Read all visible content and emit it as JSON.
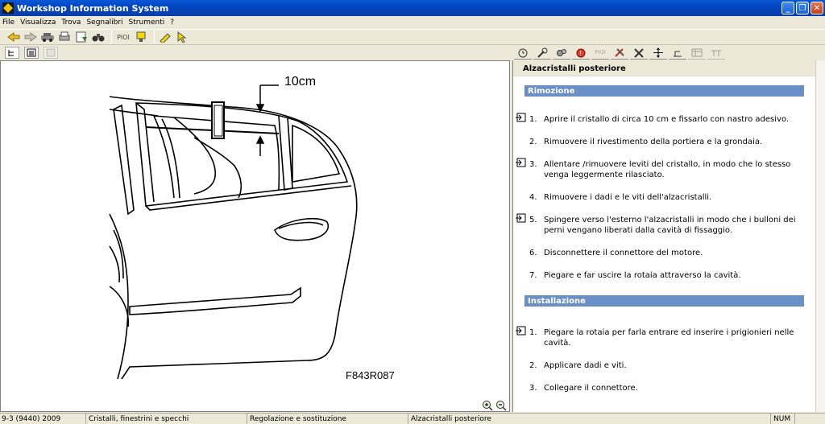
{
  "window": {
    "title": "Workshop Information System"
  },
  "menu": [
    "File",
    "Visualizza",
    "Trova",
    "Segnalibri",
    "Strumenti",
    "?"
  ],
  "toolbar": {
    "pioi_label": "PIOI"
  },
  "toolbar_right": {
    "pioi_label": "PIOI"
  },
  "figure": {
    "measure_label": "10cm",
    "code": "F843R087"
  },
  "doc": {
    "title": "Alzacristalli posteriore",
    "removal_heading": "Rimozione",
    "removal_steps": [
      {
        "n": "1.",
        "text": "Aprire il cristallo di circa 10 cm e fissarlo con nastro adesivo.",
        "link": true
      },
      {
        "n": "2.",
        "text": "Rimuovere il rivestimento della portiera e la grondaia.",
        "link": false
      },
      {
        "n": "3.",
        "text": "Allentare /rimuovere leviti del cristallo, in modo che lo stesso venga leggermente rilasciato.",
        "link": true
      },
      {
        "n": "4.",
        "text": "Rimuovere i dadi e le viti dell'alzacristalli.",
        "link": false
      },
      {
        "n": "5.",
        "text": "Spingere verso l'esterno l'alzacristalli in modo che i bulloni dei perni vengano liberati dalla cavità di fissaggio.",
        "link": true
      },
      {
        "n": "6.",
        "text": "Disconnettere il connettore del motore.",
        "link": false
      },
      {
        "n": "7.",
        "text": "Piegare e far uscire la rotaia attraverso la cavità.",
        "link": false
      }
    ],
    "install_heading": "Installazione",
    "install_steps": [
      {
        "n": "1.",
        "text": "Piegare la rotaia per farla entrare ed inserire i prigionieri nelle cavità.",
        "link": true
      },
      {
        "n": "2.",
        "text": "Applicare dadi e viti.",
        "link": false
      },
      {
        "n": "3.",
        "text": "Collegare il connettore.",
        "link": false
      }
    ]
  },
  "status": {
    "model": "9-3 (9440) 2009",
    "group": "Cristalli, finestrini e specchi",
    "operation": "Regolazione e sostituzione",
    "item": "Alzacristalli posteriore",
    "num": "NUM"
  },
  "colors": {
    "titlebar": "#0245c2",
    "section": "#6a8fc7",
    "chrome": "#ece9d8"
  }
}
